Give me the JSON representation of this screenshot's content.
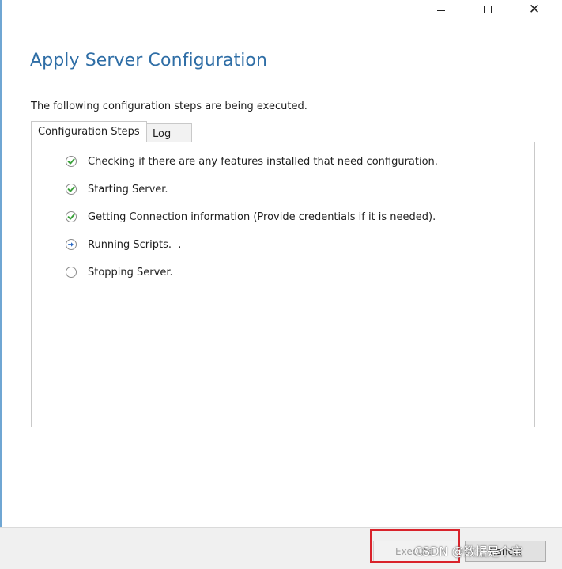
{
  "window": {
    "controls": [
      "minimize",
      "maximize",
      "close"
    ],
    "close_glyph": "✕"
  },
  "page": {
    "title": "Apply Server Configuration",
    "subtitle": "The following configuration steps are being executed."
  },
  "tabs": [
    {
      "label": "Configuration Steps",
      "active": true
    },
    {
      "label": "Log",
      "active": false
    }
  ],
  "steps": [
    {
      "label": "Checking if there are any features installed that need configuration.",
      "status": "done",
      "icon": "check-circle-icon"
    },
    {
      "label": "Starting Server.",
      "status": "done",
      "icon": "check-circle-icon"
    },
    {
      "label": "Getting Connection information (Provide credentials if it is needed).",
      "status": "done",
      "icon": "check-circle-icon"
    },
    {
      "label": "Running Scripts.  .",
      "status": "running",
      "icon": "arrow-circle-icon"
    },
    {
      "label": "Stopping Server.",
      "status": "pending",
      "icon": "empty-circle-icon"
    }
  ],
  "footer": {
    "execute_label": "Execute",
    "execute_enabled": false,
    "cancel_label": "Cancel"
  },
  "watermark": "CSDN @数据是个宝",
  "colors": {
    "title": "#2f6ea6",
    "check": "#3aa13a",
    "running": "#2e6cc4",
    "highlight": "#d9232b"
  }
}
